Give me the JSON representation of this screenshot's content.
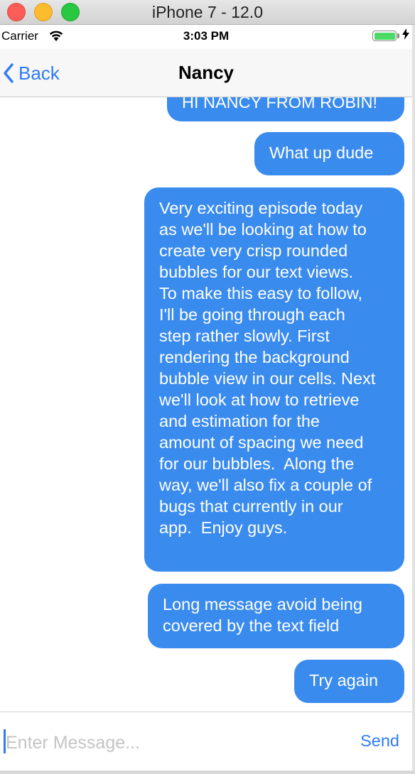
{
  "window": {
    "title": "iPhone 7 - 12.0"
  },
  "status_bar": {
    "carrier": "Carrier",
    "time": "3:03 PM",
    "wifi_icon": "wifi-icon",
    "battery_icon": "battery-icon",
    "battery_level": 1.0,
    "charging_icon": "bolt-icon"
  },
  "nav": {
    "back_label": "Back",
    "title": "Nancy"
  },
  "messages": [
    {
      "text": "HI NANCY FROM ROBIN!"
    },
    {
      "text": "What up dude"
    },
    {
      "text": "Very exciting episode today\nas we'll be looking at how to\ncreate very crisp rounded\nbubbles for our text views.\nTo make this easy to follow,\nI'll be going through each\nstep rather slowly. First\nrendering the background\nbubble view in our cells. Next\nwe'll look at how to retrieve\nand estimation for the\namount of spacing we need\nfor our bubbles.  Along the\nway, we'll also fix a couple of\nbugs that currently in our\napp.  Enjoy guys."
    },
    {
      "text": "Long message avoid being\ncovered by the text field"
    },
    {
      "text": "Try again"
    }
  ],
  "composer": {
    "placeholder": "Enter Message...",
    "value": "",
    "send_label": "Send"
  },
  "colors": {
    "bubble": "#3a8bee",
    "accent": "#2f7bf6"
  }
}
